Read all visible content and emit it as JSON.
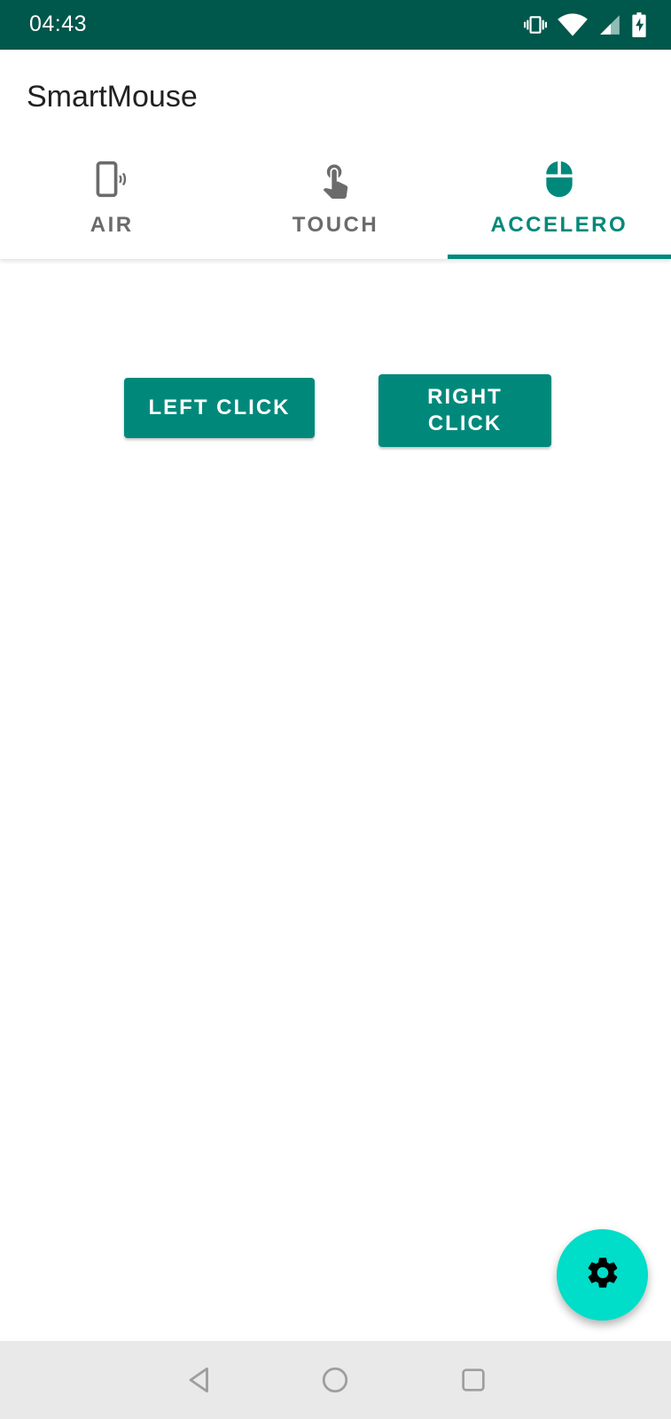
{
  "status_bar": {
    "time": "04:43",
    "icons": [
      "vibrate-icon",
      "wifi-icon",
      "signal-icon",
      "battery-charging-icon"
    ]
  },
  "app": {
    "title": "SmartMouse"
  },
  "tabs": [
    {
      "label": "AIR",
      "icon": "phone-vibrate-icon",
      "active": false
    },
    {
      "label": "TOUCH",
      "icon": "touch-app-icon",
      "active": false
    },
    {
      "label": "ACCELERO",
      "icon": "mouse-icon",
      "active": true
    }
  ],
  "buttons": {
    "left_click": "LEFT CLICK",
    "right_click": "RIGHT CLICK"
  },
  "fab": {
    "icon": "gear-icon"
  },
  "nav": {
    "icons": [
      "back-icon",
      "home-icon",
      "recents-icon"
    ]
  },
  "colors": {
    "status_bar": "#00574b",
    "accent": "#00897b",
    "fab": "#00ddc8",
    "tab_inactive": "#6b6b6b",
    "nav_bar": "#e9e9e9"
  }
}
